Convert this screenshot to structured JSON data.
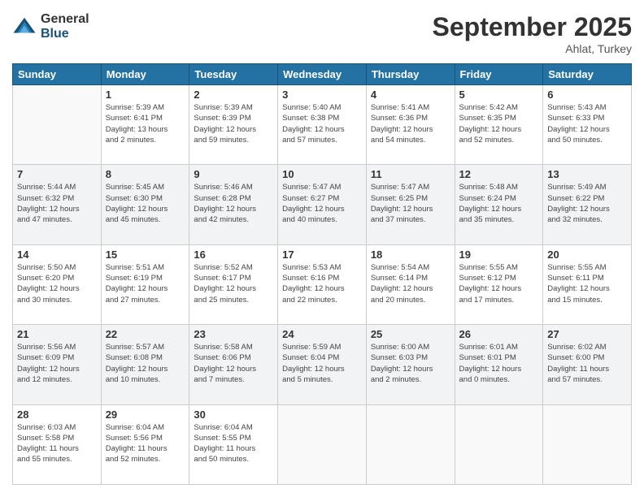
{
  "logo": {
    "general": "General",
    "blue": "Blue"
  },
  "header": {
    "month": "September 2025",
    "location": "Ahlat, Turkey"
  },
  "weekdays": [
    "Sunday",
    "Monday",
    "Tuesday",
    "Wednesday",
    "Thursday",
    "Friday",
    "Saturday"
  ],
  "weeks": [
    [
      {
        "day": "",
        "info": ""
      },
      {
        "day": "1",
        "info": "Sunrise: 5:39 AM\nSunset: 6:41 PM\nDaylight: 13 hours\nand 2 minutes."
      },
      {
        "day": "2",
        "info": "Sunrise: 5:39 AM\nSunset: 6:39 PM\nDaylight: 12 hours\nand 59 minutes."
      },
      {
        "day": "3",
        "info": "Sunrise: 5:40 AM\nSunset: 6:38 PM\nDaylight: 12 hours\nand 57 minutes."
      },
      {
        "day": "4",
        "info": "Sunrise: 5:41 AM\nSunset: 6:36 PM\nDaylight: 12 hours\nand 54 minutes."
      },
      {
        "day": "5",
        "info": "Sunrise: 5:42 AM\nSunset: 6:35 PM\nDaylight: 12 hours\nand 52 minutes."
      },
      {
        "day": "6",
        "info": "Sunrise: 5:43 AM\nSunset: 6:33 PM\nDaylight: 12 hours\nand 50 minutes."
      }
    ],
    [
      {
        "day": "7",
        "info": "Sunrise: 5:44 AM\nSunset: 6:32 PM\nDaylight: 12 hours\nand 47 minutes."
      },
      {
        "day": "8",
        "info": "Sunrise: 5:45 AM\nSunset: 6:30 PM\nDaylight: 12 hours\nand 45 minutes."
      },
      {
        "day": "9",
        "info": "Sunrise: 5:46 AM\nSunset: 6:28 PM\nDaylight: 12 hours\nand 42 minutes."
      },
      {
        "day": "10",
        "info": "Sunrise: 5:47 AM\nSunset: 6:27 PM\nDaylight: 12 hours\nand 40 minutes."
      },
      {
        "day": "11",
        "info": "Sunrise: 5:47 AM\nSunset: 6:25 PM\nDaylight: 12 hours\nand 37 minutes."
      },
      {
        "day": "12",
        "info": "Sunrise: 5:48 AM\nSunset: 6:24 PM\nDaylight: 12 hours\nand 35 minutes."
      },
      {
        "day": "13",
        "info": "Sunrise: 5:49 AM\nSunset: 6:22 PM\nDaylight: 12 hours\nand 32 minutes."
      }
    ],
    [
      {
        "day": "14",
        "info": "Sunrise: 5:50 AM\nSunset: 6:20 PM\nDaylight: 12 hours\nand 30 minutes."
      },
      {
        "day": "15",
        "info": "Sunrise: 5:51 AM\nSunset: 6:19 PM\nDaylight: 12 hours\nand 27 minutes."
      },
      {
        "day": "16",
        "info": "Sunrise: 5:52 AM\nSunset: 6:17 PM\nDaylight: 12 hours\nand 25 minutes."
      },
      {
        "day": "17",
        "info": "Sunrise: 5:53 AM\nSunset: 6:16 PM\nDaylight: 12 hours\nand 22 minutes."
      },
      {
        "day": "18",
        "info": "Sunrise: 5:54 AM\nSunset: 6:14 PM\nDaylight: 12 hours\nand 20 minutes."
      },
      {
        "day": "19",
        "info": "Sunrise: 5:55 AM\nSunset: 6:12 PM\nDaylight: 12 hours\nand 17 minutes."
      },
      {
        "day": "20",
        "info": "Sunrise: 5:55 AM\nSunset: 6:11 PM\nDaylight: 12 hours\nand 15 minutes."
      }
    ],
    [
      {
        "day": "21",
        "info": "Sunrise: 5:56 AM\nSunset: 6:09 PM\nDaylight: 12 hours\nand 12 minutes."
      },
      {
        "day": "22",
        "info": "Sunrise: 5:57 AM\nSunset: 6:08 PM\nDaylight: 12 hours\nand 10 minutes."
      },
      {
        "day": "23",
        "info": "Sunrise: 5:58 AM\nSunset: 6:06 PM\nDaylight: 12 hours\nand 7 minutes."
      },
      {
        "day": "24",
        "info": "Sunrise: 5:59 AM\nSunset: 6:04 PM\nDaylight: 12 hours\nand 5 minutes."
      },
      {
        "day": "25",
        "info": "Sunrise: 6:00 AM\nSunset: 6:03 PM\nDaylight: 12 hours\nand 2 minutes."
      },
      {
        "day": "26",
        "info": "Sunrise: 6:01 AM\nSunset: 6:01 PM\nDaylight: 12 hours\nand 0 minutes."
      },
      {
        "day": "27",
        "info": "Sunrise: 6:02 AM\nSunset: 6:00 PM\nDaylight: 11 hours\nand 57 minutes."
      }
    ],
    [
      {
        "day": "28",
        "info": "Sunrise: 6:03 AM\nSunset: 5:58 PM\nDaylight: 11 hours\nand 55 minutes."
      },
      {
        "day": "29",
        "info": "Sunrise: 6:04 AM\nSunset: 5:56 PM\nDaylight: 11 hours\nand 52 minutes."
      },
      {
        "day": "30",
        "info": "Sunrise: 6:04 AM\nSunset: 5:55 PM\nDaylight: 11 hours\nand 50 minutes."
      },
      {
        "day": "",
        "info": ""
      },
      {
        "day": "",
        "info": ""
      },
      {
        "day": "",
        "info": ""
      },
      {
        "day": "",
        "info": ""
      }
    ]
  ]
}
